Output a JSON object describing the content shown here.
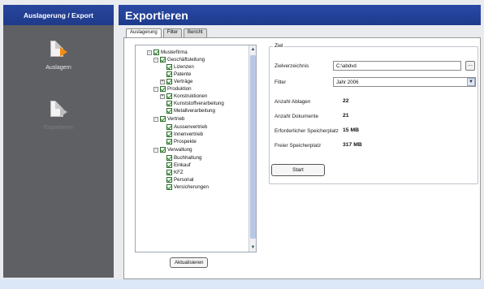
{
  "sidebar": {
    "title": "Auslagerung / Export",
    "items": [
      {
        "label": "Auslagern",
        "icon": "archive-out-icon"
      },
      {
        "label": "Exportieren",
        "icon": "export-icon"
      }
    ]
  },
  "main": {
    "title": "Exportieren",
    "tabs": [
      {
        "label": "Auslagerung"
      },
      {
        "label": "Filter"
      },
      {
        "label": "Bericht"
      }
    ]
  },
  "tree": {
    "items": [
      {
        "label": "Musterfirma",
        "expander": "-"
      },
      {
        "label": "Geschäftsleitung",
        "expander": "-"
      },
      {
        "label": "Lizenzen"
      },
      {
        "label": "Patente"
      },
      {
        "label": "Verträge",
        "expander": "+"
      },
      {
        "label": "Produktion",
        "expander": "-"
      },
      {
        "label": "Konstruktionen",
        "expander": "+"
      },
      {
        "label": "Kunststoffverarbeitung"
      },
      {
        "label": "Metallverarbeitung"
      },
      {
        "label": "Vertrieb",
        "expander": "-"
      },
      {
        "label": "Aussenvertrieb"
      },
      {
        "label": "Innenvertrieb"
      },
      {
        "label": "Prospekte"
      },
      {
        "label": "Verwaltung",
        "expander": "-"
      },
      {
        "label": "Buchhaltung"
      },
      {
        "label": "Einkauf"
      },
      {
        "label": "KFZ"
      },
      {
        "label": "Personal"
      },
      {
        "label": "Versicherungen"
      }
    ],
    "refresh_label": "Aktualisieren"
  },
  "ziel": {
    "group_label": "Ziel",
    "directory_label": "Zielverzeichnis",
    "directory_value": "C:\\abdvd",
    "browse_label": "...",
    "filter_label": "Filter",
    "filter_value": "Jahr 2006",
    "stats": [
      {
        "label": "Anzahl Ablagen",
        "value": "22"
      },
      {
        "label": "Anzahl Dokumente",
        "value": "21"
      },
      {
        "label": "Erforderlicher Speicherplatz",
        "value": "15 MB"
      },
      {
        "label": "Freier Speicherplatz",
        "value": "317 MB"
      }
    ],
    "start_label": "Start"
  },
  "colors": {
    "title_bar": "#2a4aa6",
    "sidebar_bg": "#5f6064",
    "accent_arrow": "#f08c14",
    "check_green": "#1b8a1b"
  }
}
